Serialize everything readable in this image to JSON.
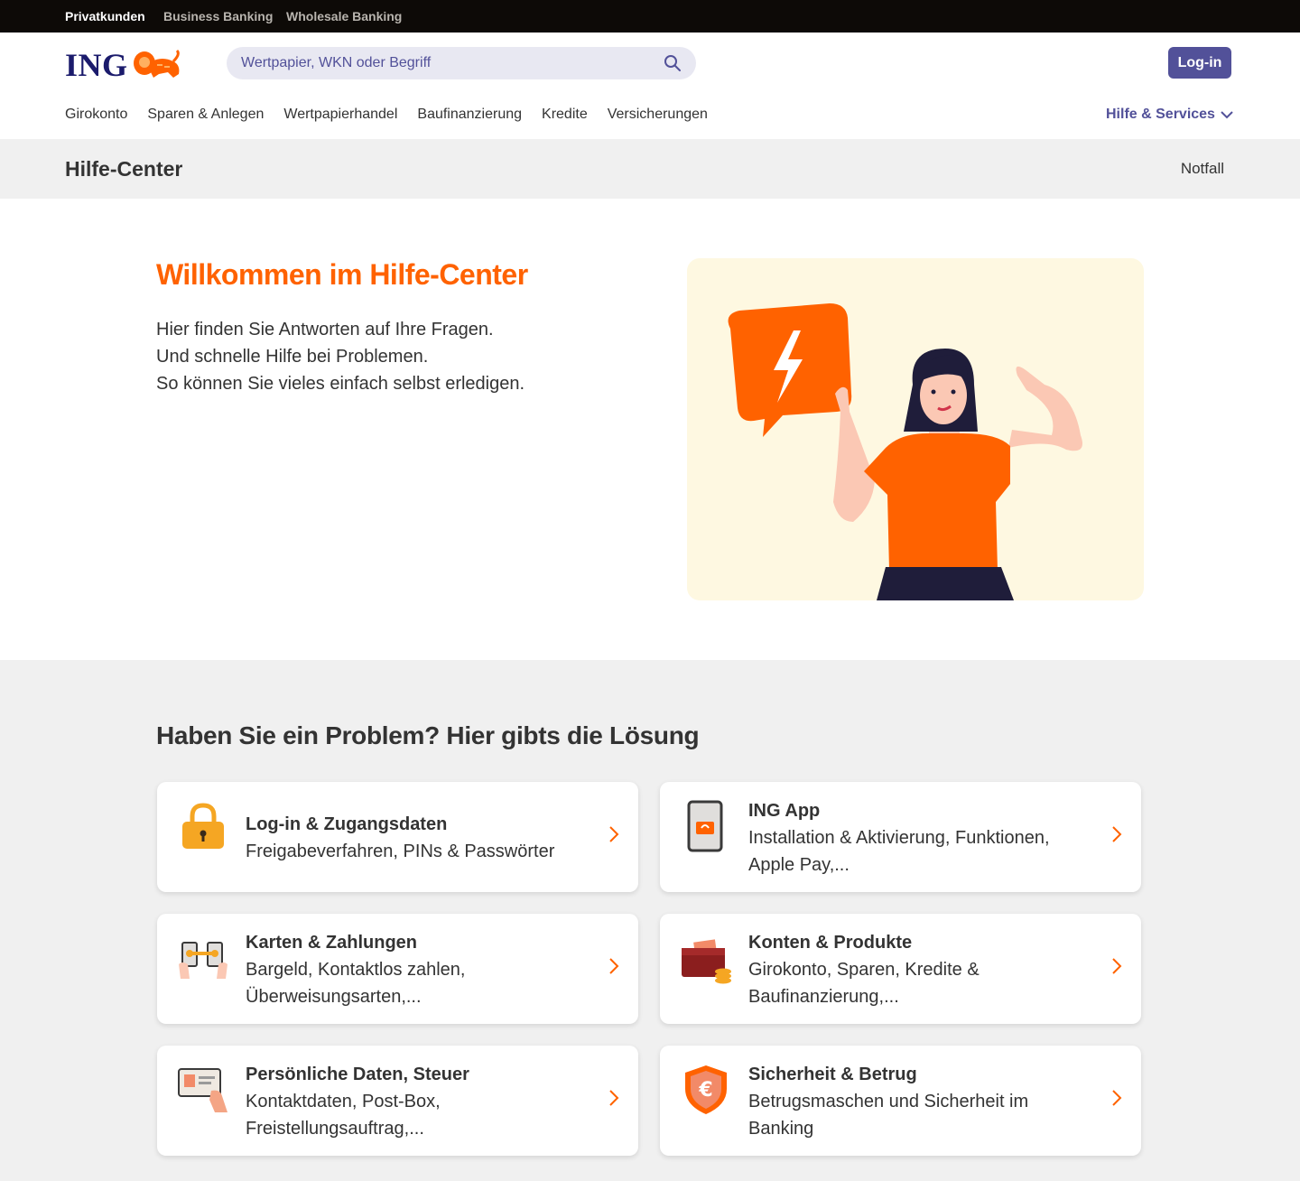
{
  "segments": {
    "privat": "Privatkunden",
    "business": "Business Banking",
    "wholesale": "Wholesale Banking"
  },
  "header": {
    "logo_text": "ING",
    "search_placeholder": "Wertpapier, WKN oder Begriff",
    "login_label": "Log-in",
    "nav": [
      "Girokonto",
      "Sparen & Anlegen",
      "Wertpapierhandel",
      "Baufinanzierung",
      "Kredite",
      "Versicherungen"
    ],
    "help_label": "Hilfe & Services"
  },
  "subheader": {
    "title": "Hilfe-Center",
    "notfall": "Notfall"
  },
  "hero": {
    "title": "Willkommen im Hilfe-Center",
    "lines": [
      "Hier finden Sie Antworten auf Ihre Fragen.",
      "Und schnelle Hilfe bei Problemen.",
      "So können Sie vieles einfach selbst erledigen."
    ]
  },
  "problems": {
    "heading": "Haben Sie ein Problem? Hier gibts die Lösung",
    "cards": [
      {
        "title": "Log-in & Zugangsdaten",
        "desc": "Freigabeverfahren, PINs & Passwörter",
        "icon": "lock-icon"
      },
      {
        "title": "ING App",
        "desc": "Installation & Aktivierung, Funktionen, Apple Pay,...",
        "icon": "phone-icon"
      },
      {
        "title": "Karten & Zahlungen",
        "desc": "Bargeld, Kontaktlos zahlen, Überweisungsarten,...",
        "icon": "payment-icon"
      },
      {
        "title": "Konten & Produkte",
        "desc": "Girokonto, Sparen, Kredite & Baufinanzierung,...",
        "icon": "wallet-icon"
      },
      {
        "title": "Persönliche Daten, Steuer",
        "desc": "Kontaktdaten, Post-Box, Freistellungsauftrag,...",
        "icon": "id-card-icon"
      },
      {
        "title": "Sicherheit & Betrug",
        "desc": "Betrugsmaschen und Sicherheit im Banking",
        "icon": "shield-euro-icon"
      }
    ]
  },
  "colors": {
    "orange": "#ff6200",
    "indigo": "#525199",
    "dark_bar": "#0d0a07",
    "grey_bg": "#f0f0f0"
  }
}
